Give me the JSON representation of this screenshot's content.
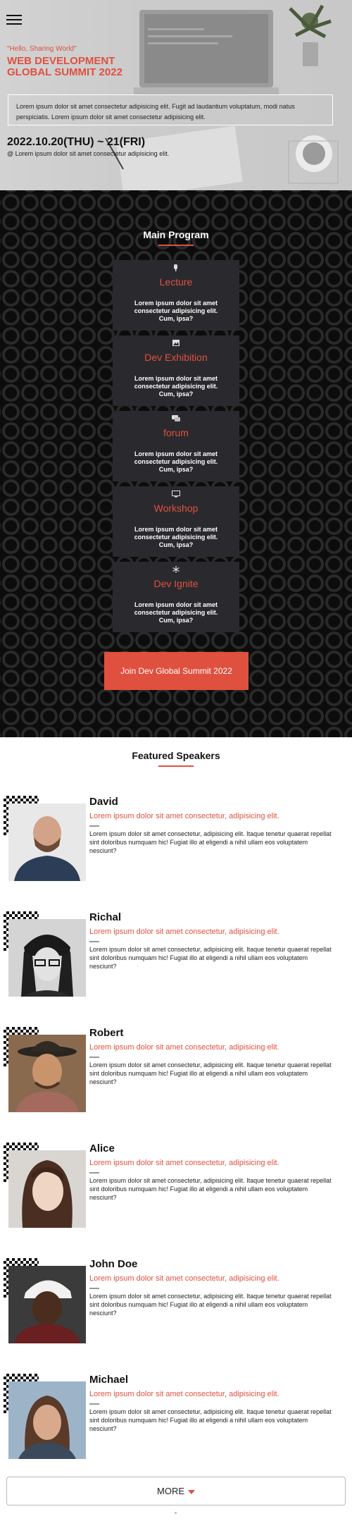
{
  "hero": {
    "tagline": "\"Hello, Sharing World\"",
    "title": "WEB DEVELOPMENT GLOBAL SUMMIT 2022",
    "description": "Lorem ipsum dolor sit amet consectetur adipisicing elit. Fugit ad laudantium voluptatum, modi natus perspiciatis. Lorem ipsum dolor sit amet consectetur adipisicing elit.",
    "date": "2022.10.20(THU) ~ 21(FRI)",
    "venue": "@ Lorem ipsum dolor sit amet consectetur adipisicing elit.",
    "menu_icon": "hamburger-menu-icon"
  },
  "program": {
    "title": "Main Program",
    "cards": [
      {
        "title": "Lecture",
        "icon": "microphone-icon",
        "text": "Lorem ipsum dolor sit amet consectetur adipisicing elit. Cum, ipsa?"
      },
      {
        "title": "Dev Exhibition",
        "icon": "image-icon",
        "text": "Lorem ipsum dolor sit amet consectetur adipisicing elit. Cum, ipsa?"
      },
      {
        "title": "forum",
        "icon": "chat-icon",
        "text": "Lorem ipsum dolor sit amet consectetur adipisicing elit. Cum, ipsa?"
      },
      {
        "title": "Workshop",
        "icon": "monitor-icon",
        "text": "Lorem ipsum dolor sit amet consectetur adipisicing elit. Cum, ipsa?"
      },
      {
        "title": "Dev Ignite",
        "icon": "snowflake-icon",
        "text": "Lorem ipsum dolor sit amet consectetur adipisicing elit. Cum, ipsa?"
      }
    ],
    "join_label": "Join Dev Global Summit 2022"
  },
  "speakers": {
    "title": "Featured Speakers",
    "items": [
      {
        "name": "David",
        "role": "Lorem ipsum dolor sit amet consectetur, adipisicing elit.",
        "bio": "Lorem ipsum dolor sit amet consectetur, adipisicing elit. Itaque tenetur quaerat repellat sint doloribus numquam hic! Fugiat illo at eligendi a nihil ullam eos voluptatem nesciunt?"
      },
      {
        "name": "Richal",
        "role": "Lorem ipsum dolor sit amet consectetur, adipisicing elit.",
        "bio": "Lorem ipsum dolor sit amet consectetur, adipisicing elit. Itaque tenetur quaerat repellat sint doloribus numquam hic! Fugiat illo at eligendi a nihil ullam eos voluptatem nesciunt?"
      },
      {
        "name": "Robert",
        "role": "Lorem ipsum dolor sit amet consectetur, adipisicing elit.",
        "bio": "Lorem ipsum dolor sit amet consectetur, adipisicing elit. Itaque tenetur quaerat repellat sint doloribus numquam hic! Fugiat illo at eligendi a nihil ullam eos voluptatem nesciunt?"
      },
      {
        "name": "Alice",
        "role": "Lorem ipsum dolor sit amet consectetur, adipisicing elit.",
        "bio": "Lorem ipsum dolor sit amet consectetur, adipisicing elit. Itaque tenetur quaerat repellat sint doloribus numquam hic! Fugiat illo at eligendi a nihil ullam eos voluptatem nesciunt?"
      },
      {
        "name": "John Doe",
        "role": "Lorem ipsum dolor sit amet consectetur, adipisicing elit.",
        "bio": "Lorem ipsum dolor sit amet consectetur, adipisicing elit. Itaque tenetur quaerat repellat sint doloribus numquam hic! Fugiat illo at eligendi a nihil ullam eos voluptatem nesciunt?"
      },
      {
        "name": "Michael",
        "role": "Lorem ipsum dolor sit amet consectetur, adipisicing elit.",
        "bio": "Lorem ipsum dolor sit amet consectetur, adipisicing elit. Itaque tenetur quaerat repellat sint doloribus numquam hic! Fugiat illo at eligendi a nihil ullam eos voluptatem nesciunt?"
      }
    ],
    "more_label": "MORE"
  },
  "colors": {
    "accent": "#e0503f",
    "dark_bg": "#0c0c0c",
    "card_bg": "#2a2a2e"
  }
}
